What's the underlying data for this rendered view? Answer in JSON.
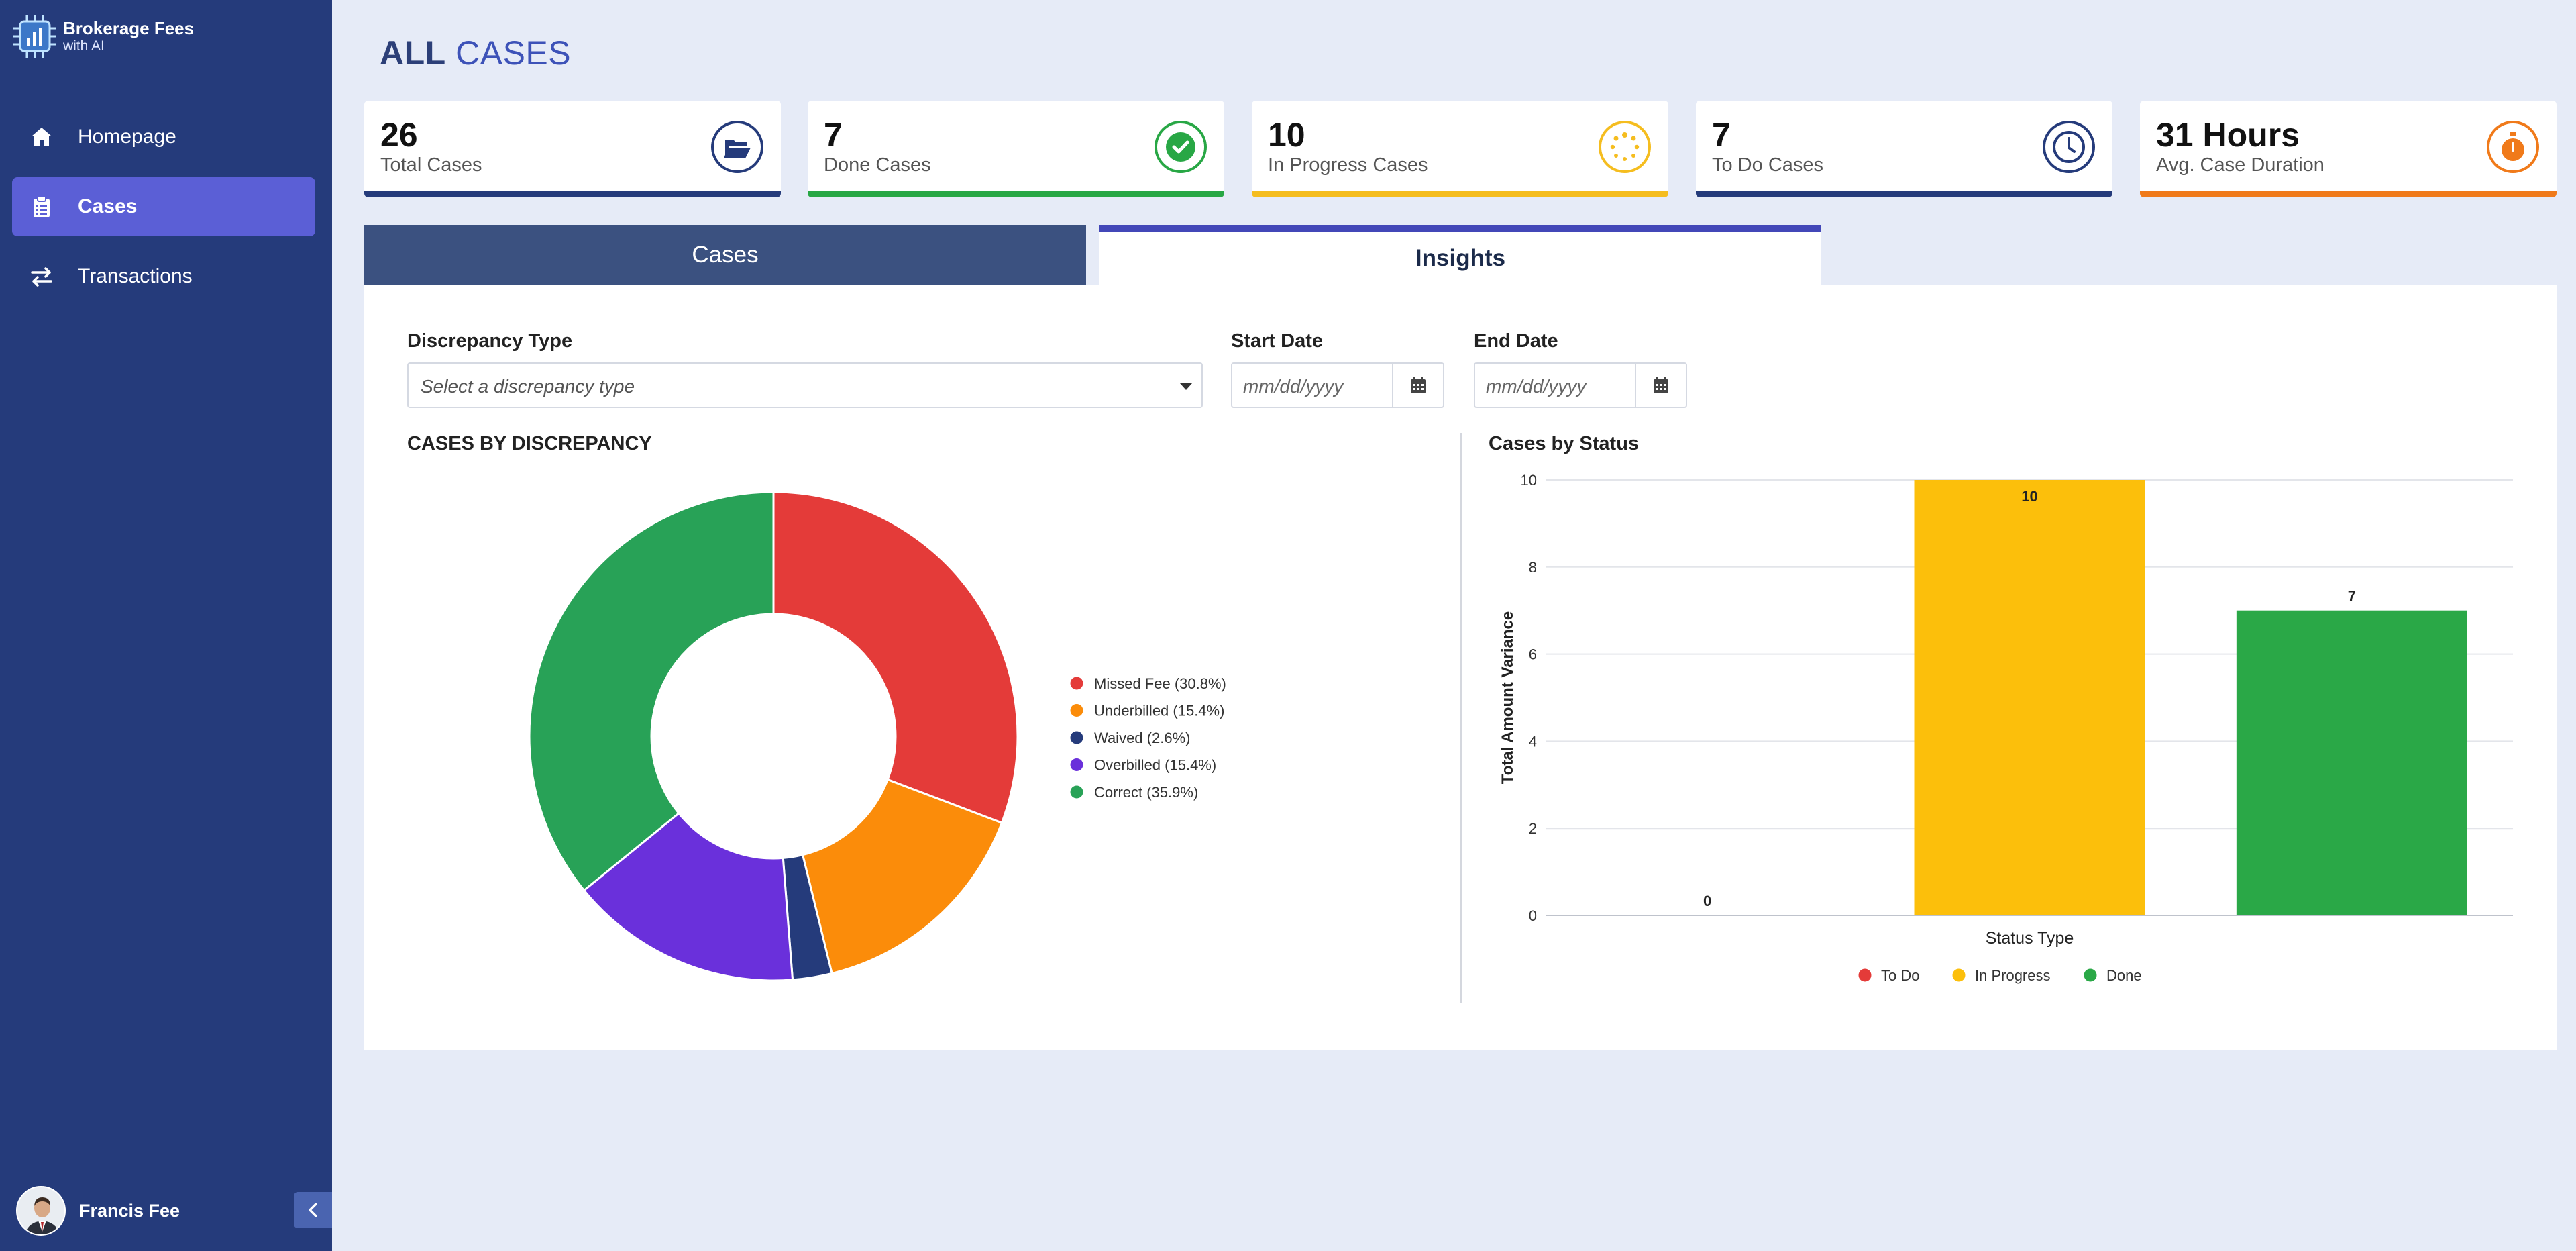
{
  "app": {
    "title": "Brokerage Fees",
    "subtitle": "with AI"
  },
  "sidebar": {
    "items": [
      {
        "label": "Homepage",
        "icon": "home-icon",
        "active": false
      },
      {
        "label": "Cases",
        "icon": "clipboard-icon",
        "active": true
      },
      {
        "label": "Transactions",
        "icon": "transfer-arrows-icon",
        "active": false
      }
    ],
    "user": {
      "name": "Francis Fee"
    }
  },
  "header": {
    "title_bold": "ALL",
    "title_rest": "CASES"
  },
  "stats": [
    {
      "value": "26",
      "label": "Total Cases",
      "icon": "folder-open-icon",
      "color": "#253b7b"
    },
    {
      "value": "7",
      "label": "Done Cases",
      "icon": "check-circle-icon",
      "color": "#28a745"
    },
    {
      "value": "10",
      "label": "In Progress Cases",
      "icon": "spinner-icon",
      "color": "#f5bd1f"
    },
    {
      "value": "7",
      "label": "To Do Cases",
      "icon": "clock-icon",
      "color": "#253b7b"
    },
    {
      "value": "31 Hours",
      "label": "Avg. Case Duration",
      "icon": "stopwatch-icon",
      "color": "#f07a1a"
    }
  ],
  "tabs": {
    "cases": "Cases",
    "insights": "Insights",
    "active": "insights"
  },
  "filters": {
    "discrepancy_label": "Discrepancy Type",
    "discrepancy_placeholder": "Select a discrepancy type",
    "start_label": "Start Date",
    "start_placeholder": "mm/dd/yyyy",
    "end_label": "End Date",
    "end_placeholder": "mm/dd/yyyy"
  },
  "chart_data": [
    {
      "type": "pie",
      "title": "CASES BY DISCREPANCY",
      "donut": true,
      "legend_position": "right",
      "slices": [
        {
          "label": "Missed Fee (30.8%)",
          "value": 30.8,
          "color": "#e43b39"
        },
        {
          "label": "Underbilled (15.4%)",
          "value": 15.4,
          "color": "#fb8c0a"
        },
        {
          "label": "Waived (2.6%)",
          "value": 2.6,
          "color": "#253b7b"
        },
        {
          "label": "Overbilled (15.4%)",
          "value": 15.4,
          "color": "#6a30db"
        },
        {
          "label": "Correct (35.9%)",
          "value": 35.9,
          "color": "#28a257"
        }
      ]
    },
    {
      "type": "bar",
      "title": "Cases by Status",
      "xlabel": "Status Type",
      "ylabel": "Total Amount Variance",
      "ylim": [
        0,
        10
      ],
      "yticks": [
        "0",
        "2",
        "4",
        "6",
        "8",
        "10"
      ],
      "grid": true,
      "legend_position": "bottom",
      "categories": [
        "To Do",
        "In Progress",
        "Done"
      ],
      "values": [
        0,
        10,
        7
      ],
      "colors": [
        "#e43b39",
        "#fcbf0b",
        "#2aa847"
      ]
    }
  ]
}
